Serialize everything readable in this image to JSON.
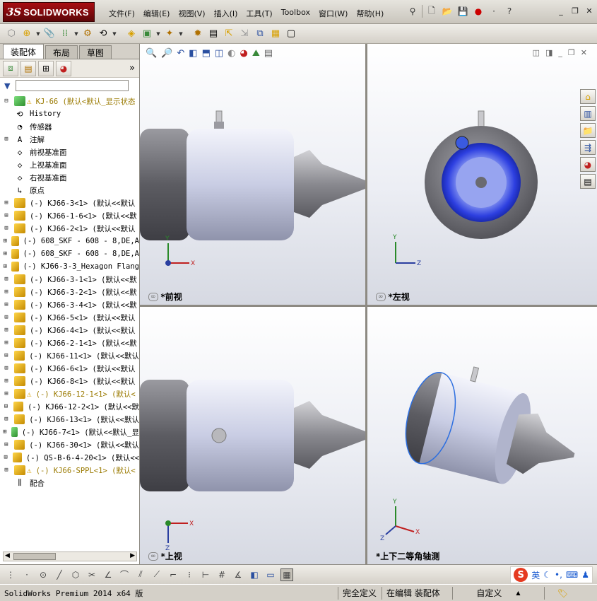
{
  "app": {
    "logo_ds": "3S",
    "logo_text": "SOLIDWORKS",
    "menu": [
      "文件(F)",
      "编辑(E)",
      "视图(V)",
      "插入(I)",
      "工具(T)",
      "Toolbox",
      "窗口(W)",
      "帮助(H)"
    ]
  },
  "left_panel": {
    "tabs": [
      "装配体",
      "布局",
      "草图"
    ],
    "tree": {
      "root": "KJ-66  (默认<默认_显示状态",
      "items": [
        {
          "label": "History",
          "icon": "history-icon",
          "expand": false
        },
        {
          "label": "传感器",
          "icon": "sensor-icon",
          "expand": false
        },
        {
          "label": "注解",
          "icon": "annotation-icon",
          "expand": true
        },
        {
          "label": "前视基准面",
          "icon": "plane-icon",
          "expand": false
        },
        {
          "label": "上视基准面",
          "icon": "plane-icon",
          "expand": false
        },
        {
          "label": "右视基准面",
          "icon": "plane-icon",
          "expand": false
        },
        {
          "label": "原点",
          "icon": "origin-icon",
          "expand": false
        },
        {
          "label": "(-) KJ66-3<1> (默认<<默认",
          "icon": "part-icon",
          "expand": true
        },
        {
          "label": "(-) KJ66-1-6<1> (默认<<默",
          "icon": "part-icon",
          "expand": true
        },
        {
          "label": "(-) KJ66-2<1> (默认<<默认",
          "icon": "part-icon",
          "expand": true
        },
        {
          "label": "(-) 608_SKF - 608 - 8,DE,A",
          "icon": "part-icon",
          "expand": true
        },
        {
          "label": "(-) 608_SKF - 608 - 8,DE,A",
          "icon": "part-icon",
          "expand": true
        },
        {
          "label": "(-) KJ66-3-3_Hexagon Flang",
          "icon": "part-icon",
          "expand": true
        },
        {
          "label": "(-) KJ66-3-1<1> (默认<<默",
          "icon": "part-icon",
          "expand": true
        },
        {
          "label": "(-) KJ66-3-2<1> (默认<<默",
          "icon": "part-icon",
          "expand": true
        },
        {
          "label": "(-) KJ66-3-4<1> (默认<<默",
          "icon": "part-icon",
          "expand": true
        },
        {
          "label": "(-) KJ66-5<1> (默认<<默认",
          "icon": "part-icon",
          "expand": true
        },
        {
          "label": "(-) KJ66-4<1> (默认<<默认",
          "icon": "part-icon",
          "expand": true
        },
        {
          "label": "(-) KJ66-2-1<1> (默认<<默",
          "icon": "part-icon",
          "expand": true
        },
        {
          "label": "(-) KJ66-11<1> (默认<<默认",
          "icon": "part-icon",
          "expand": true
        },
        {
          "label": "(-) KJ66-6<1> (默认<<默认",
          "icon": "part-icon",
          "expand": true
        },
        {
          "label": "(-) KJ66-8<1> (默认<<默认",
          "icon": "part-icon",
          "expand": true
        },
        {
          "label": "(-) KJ66-12-1<1> (默认<",
          "icon": "part-icon",
          "expand": true,
          "warning": true
        },
        {
          "label": "(-) KJ66-12-2<1> (默认<<默",
          "icon": "part-icon",
          "expand": true
        },
        {
          "label": "(-) KJ66-13<1> (默认<<默认",
          "icon": "part-icon",
          "expand": true
        },
        {
          "label": "(-) KJ66-7<1> (默认<<默认_显",
          "icon": "part-green-icon",
          "expand": true
        },
        {
          "label": "(-) KJ66-30<1> (默认<<默认",
          "icon": "part-icon",
          "expand": true
        },
        {
          "label": "(-) QS-B-6-4-20<1> (默认<<",
          "icon": "part-icon",
          "expand": true
        },
        {
          "label": "(-) KJ66-SPPL<1> (默认<",
          "icon": "part-icon",
          "expand": true,
          "warning": true
        },
        {
          "label": "配合",
          "icon": "mate-icon",
          "expand": false
        }
      ]
    }
  },
  "viewports": {
    "front": "*前视",
    "left": "*左视",
    "top": "*上视",
    "iso": "*上下二等角轴测"
  },
  "axis_labels": {
    "x": "X",
    "y": "Y",
    "z": "Z"
  },
  "ime": {
    "lang": "英"
  },
  "status": {
    "app_version": "SolidWorks Premium 2014 x64 版",
    "defined": "完全定义",
    "editing": "在编辑 装配体",
    "units": "自定义"
  },
  "colors": {
    "engine_body": "#d9dcef",
    "engine_cap": "#6e6e72",
    "nozzle": "#9a9aa0",
    "intake_ring": "#2d3fe0",
    "tree_warning": "#9a7a00"
  }
}
